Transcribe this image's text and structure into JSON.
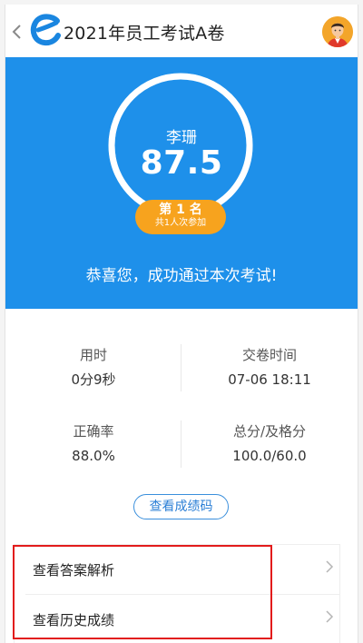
{
  "header": {
    "title": "2021年员工考试A卷",
    "back_icon": "chevron-left-icon",
    "logo_icon": "e-logo-icon",
    "avatar_icon": "user-avatar-icon"
  },
  "score": {
    "name": "李珊",
    "value": "87.5",
    "rank_label": "第 1 名",
    "participants": "共1人次参加",
    "message": "恭喜您，成功通过本次考试!",
    "ring_fill": 0.875
  },
  "stats": {
    "time_label": "用时",
    "time_value": "0分9秒",
    "submit_label": "交卷时间",
    "submit_value": "07-06 18:11",
    "accuracy_label": "正确率",
    "accuracy_value": "88.0%",
    "score_label": "总分/及格分",
    "score_value": "100.0/60.0"
  },
  "actions": {
    "score_code": "查看成绩码",
    "view_analysis": "查看答案解析",
    "view_history": "查看历史成绩"
  },
  "colors": {
    "primary": "#1e90ea",
    "badge": "#f7a31e",
    "highlight": "#e21b1b"
  }
}
